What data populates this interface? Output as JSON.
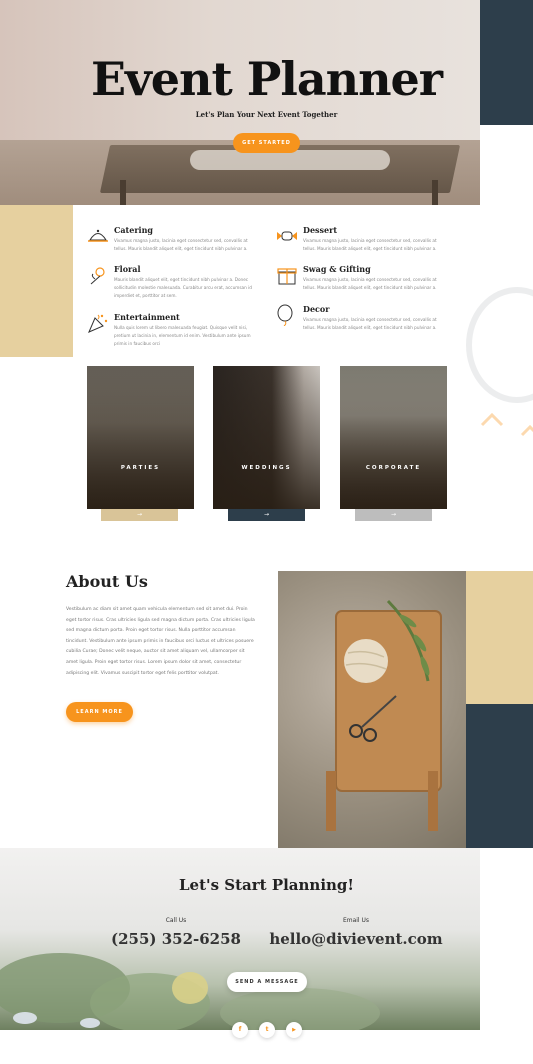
{
  "hero": {
    "title": "Event Planner",
    "subtitle": "Let's Plan Your Next Event Together",
    "cta": "GET STARTED"
  },
  "services": [
    {
      "title": "Catering",
      "icon": "cloche-icon",
      "text": "Vivamus magna justo, lacinia eget consectetur sed, convallis at tellus. Mauris blandit aliquet elit, eget tincidunt nibh pulvinar a."
    },
    {
      "title": "Dessert",
      "icon": "candy-icon",
      "text": "Vivamus magna justo, lacinia eget consectetur sed, convallis at tellus. Mauris blandit aliquet elit, eget tincidunt nibh pulvinar a."
    },
    {
      "title": "Floral",
      "icon": "flower-icon",
      "text": "Mauris blandit aliquet elit, eget tincidunt nibh pulvinar a. Donec sollicitudin molestie malesuada. Curabitur arcu erat, accumsan id imperdiet et, porttitor at sem."
    },
    {
      "title": "Swag & Gifting",
      "icon": "gift-icon",
      "text": "Vivamus magna justo, lacinia eget consectetur sed, convallis at tellus. Mauris blandit aliquet elit, eget tincidunt nibh pulvinar a."
    },
    {
      "title": "Entertainment",
      "icon": "party-popper-icon",
      "text": "Nulla quis lorem ut libero malesuada feugiat. Quisque velit nisi, pretium ut lacinia in, elementum id enim. Vestibulum ante ipsum primis in faucibus orci"
    },
    {
      "title": "Decor",
      "icon": "balloon-icon",
      "text": "Vivamus magna justo, lacinia eget consectetur sed, convallis at tellus. Mauris blandit aliquet elit, eget tincidunt nibh pulvinar a."
    }
  ],
  "cards": [
    {
      "label": "PARTIES",
      "arrow": "→",
      "bar_color": "#d9c498"
    },
    {
      "label": "WEDDINGS",
      "arrow": "→",
      "bar_color": "#2d3e4b"
    },
    {
      "label": "CORPORATE",
      "arrow": "→",
      "bar_color": "#bdbdbd"
    }
  ],
  "about": {
    "title": "About Us",
    "text": "Vestibulum ac diam sit amet quam vehicula elementum sed sit amet dui. Proin eget tortor risus. Cras ultricies ligula sed magna dictum porta. Cras ultricies ligula sed magna dictum porta. Proin eget tortor risus. Nulla porttitor accumsan tincidunt. Vestibulum ante ipsum primis in faucibus orci luctus et ultrices posuere cubilia Curae; Donec velit neque, auctor sit amet aliquam vel, ullamcorper sit amet ligula. Proin eget tortor risus. Lorem ipsum dolor sit amet, consectetur adipiscing elit. Vivamus suscipit tortor eget felis porttitor volutpat.",
    "cta": "LEARN MORE"
  },
  "contact": {
    "title": "Let's Start Planning!",
    "call_label": "Call Us",
    "phone": "(255) 352-6258",
    "email_label": "Email Us",
    "email": "hello@divievent.com",
    "cta": "SEND A MESSAGE"
  },
  "social": [
    {
      "icon": "facebook-icon",
      "glyph": "f"
    },
    {
      "icon": "twitter-icon",
      "glyph": "t"
    },
    {
      "icon": "youtube-icon",
      "glyph": "▶"
    }
  ],
  "colors": {
    "accent": "#f7941d",
    "navy": "#2d3e4b",
    "tan": "#e6d09f"
  }
}
